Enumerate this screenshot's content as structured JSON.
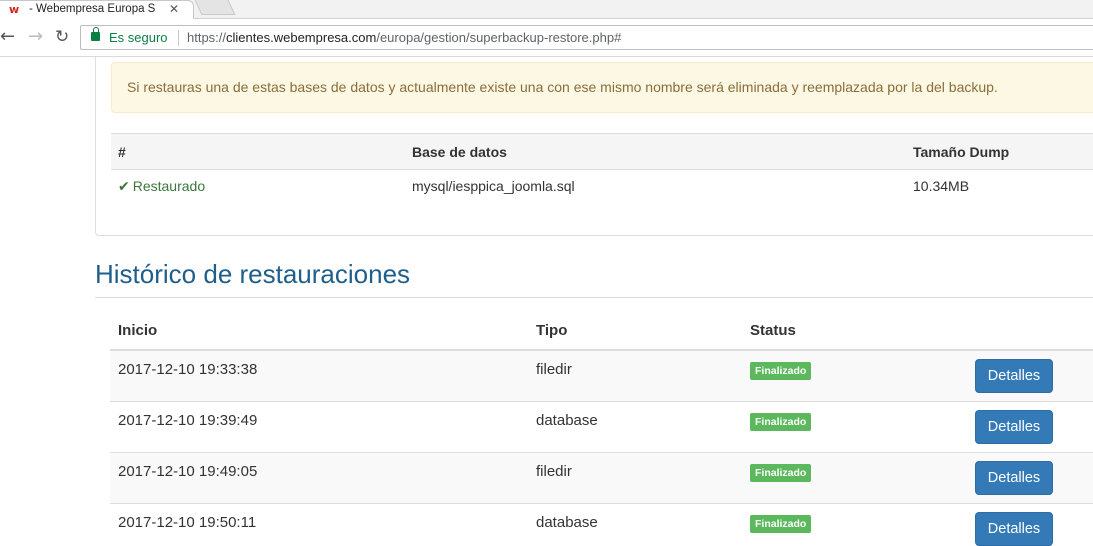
{
  "browser": {
    "tab_title": "- Webempresa Europa S",
    "tab_favicon": "w",
    "tab_close": "✕",
    "secure_label": "Es seguro",
    "url_scheme": "https://",
    "url_host": "clientes.webempresa.com",
    "url_path": "/europa/gestion/superbackup-restore.php#",
    "back_icon": "←",
    "forward_icon": "→",
    "reload_icon": "↻"
  },
  "alert": {
    "text": "Si restauras una de estas bases de datos y actualmente existe una con ese mismo nombre será eliminada y reemplazada por la del backup."
  },
  "db_table": {
    "headers": [
      "#",
      "Base de datos",
      "Tamaño Dump"
    ],
    "rows": [
      {
        "status": "Restaurado",
        "status_icon": "✔",
        "database": "mysql/iesppica_joomla.sql",
        "size": "10.34MB"
      }
    ]
  },
  "history": {
    "title": "Histórico de restauraciones",
    "headers": [
      "Inicio",
      "Tipo",
      "Status"
    ],
    "rows": [
      {
        "inicio": "2017-12-10 19:33:38",
        "tipo": "filedir",
        "status": "Finalizado",
        "action": "Detalles"
      },
      {
        "inicio": "2017-12-10 19:39:49",
        "tipo": "database",
        "status": "Finalizado",
        "action": "Detalles"
      },
      {
        "inicio": "2017-12-10 19:49:05",
        "tipo": "filedir",
        "status": "Finalizado",
        "action": "Detalles"
      },
      {
        "inicio": "2017-12-10 19:50:11",
        "tipo": "database",
        "status": "Finalizado",
        "action": "Detalles"
      }
    ]
  },
  "colors": {
    "badge_success": "#5cb85c",
    "button_primary": "#337ab7",
    "alert_bg": "#fcf8e3",
    "title_blue": "#1f5f8b"
  }
}
